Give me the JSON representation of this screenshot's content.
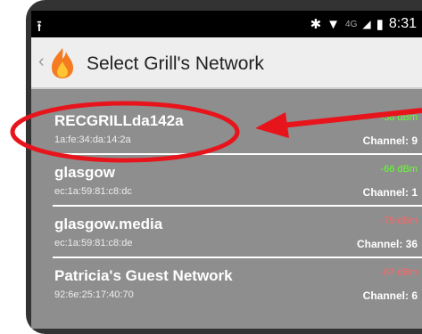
{
  "status_bar": {
    "usb_icon": "usb-upload-icon",
    "bluetooth_icon": "bluetooth-icon",
    "wifi_icon": "wifi-icon",
    "network_label": "4G",
    "signal_icon": "cell-signal-icon",
    "battery_icon": "battery-icon",
    "time": "8:31"
  },
  "action_bar": {
    "back_icon": "chevron-left-icon",
    "app_icon": "flame-icon",
    "title": "Select Grill's Network"
  },
  "networks": [
    {
      "ssid": "RECGRILLda142a",
      "bssid": "1a:fe:34:da:14:2a",
      "signal": "-58 dBm",
      "channel": "Channel: 9"
    },
    {
      "ssid": "glasgow",
      "bssid": "ec:1a:59:81:c8:dc",
      "signal": "-66 dBm",
      "channel": "Channel: 1"
    },
    {
      "ssid": "glasgow.media",
      "bssid": "ec:1a:59:81:c8:de",
      "signal": "-79 dBm",
      "channel": "Channel: 36"
    },
    {
      "ssid": "Patricia's Guest Network",
      "bssid": "92:6e:25:17:40:70",
      "signal": "-87 dBm",
      "channel": "Channel: 6"
    }
  ],
  "colors": {
    "signal_good": "#66ff33",
    "signal_bad": "#ff6666",
    "annotation_red": "#e8141c"
  }
}
